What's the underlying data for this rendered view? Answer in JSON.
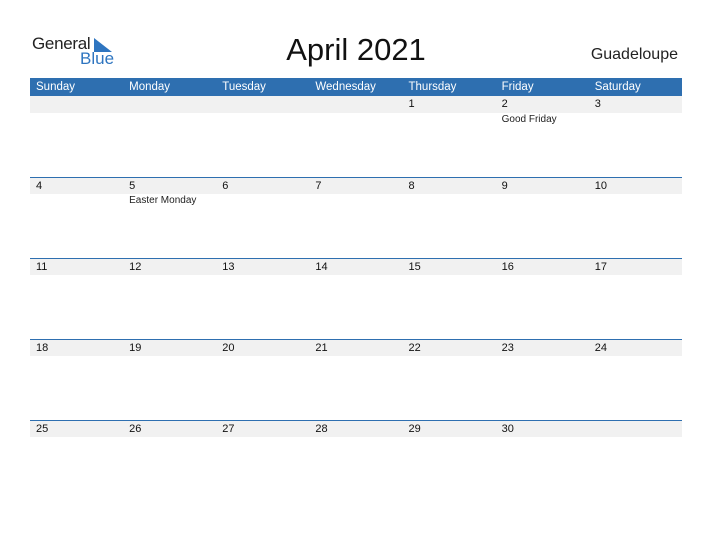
{
  "logo": {
    "word1": "General",
    "word2": "Blue"
  },
  "title": "April 2021",
  "region": "Guadeloupe",
  "colors": {
    "accent": "#2e6fb0",
    "date_strip": "#f1f1f1"
  },
  "weekdays": [
    "Sunday",
    "Monday",
    "Tuesday",
    "Wednesday",
    "Thursday",
    "Friday",
    "Saturday"
  ],
  "weeks": [
    {
      "days": [
        "",
        "",
        "",
        "",
        "1",
        "2",
        "3"
      ],
      "events": [
        "",
        "",
        "",
        "",
        "",
        "Good Friday",
        ""
      ]
    },
    {
      "days": [
        "4",
        "5",
        "6",
        "7",
        "8",
        "9",
        "10"
      ],
      "events": [
        "",
        "Easter Monday",
        "",
        "",
        "",
        "",
        ""
      ]
    },
    {
      "days": [
        "11",
        "12",
        "13",
        "14",
        "15",
        "16",
        "17"
      ],
      "events": [
        "",
        "",
        "",
        "",
        "",
        "",
        ""
      ]
    },
    {
      "days": [
        "18",
        "19",
        "20",
        "21",
        "22",
        "23",
        "24"
      ],
      "events": [
        "",
        "",
        "",
        "",
        "",
        "",
        ""
      ]
    },
    {
      "days": [
        "25",
        "26",
        "27",
        "28",
        "29",
        "30",
        ""
      ],
      "events": [
        "",
        "",
        "",
        "",
        "",
        "",
        ""
      ]
    }
  ]
}
